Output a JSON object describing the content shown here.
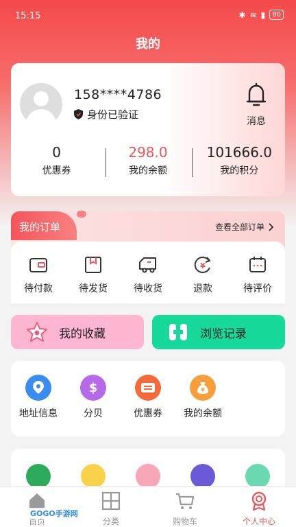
{
  "status_bar": {
    "time": "15:15",
    "battery": "80"
  },
  "page_title": "我的",
  "profile": {
    "phone": "158****4786",
    "verified_text": "身份已验证",
    "message_label": "消息",
    "stats": [
      {
        "value": "0",
        "label": "优惠券",
        "highlight": false
      },
      {
        "value": "298.0",
        "label": "我的余额",
        "highlight": true
      },
      {
        "value": "101666.0",
        "label": "我的积分",
        "highlight": false
      }
    ]
  },
  "orders": {
    "title": "我的订单",
    "view_all": "查看全部订单",
    "items": [
      {
        "label": "待付款",
        "icon": "wallet-icon"
      },
      {
        "label": "待发货",
        "icon": "box-icon"
      },
      {
        "label": "待收货",
        "icon": "truck-icon"
      },
      {
        "label": "退款",
        "icon": "refund-icon"
      },
      {
        "label": "待评价",
        "icon": "review-icon"
      }
    ]
  },
  "quick_actions": {
    "favorites": "我的收藏",
    "history": "浏览记录"
  },
  "services": [
    {
      "label": "地址信息",
      "icon": "location-icon",
      "color": "#3a8df0"
    },
    {
      "label": "分贝",
      "icon": "dollar-icon",
      "color": "#b56ae8"
    },
    {
      "label": "优惠券",
      "icon": "coupon-icon",
      "color": "#f46a3a"
    },
    {
      "label": "我的余额",
      "icon": "moneybag-icon",
      "color": "#f59e3a"
    }
  ],
  "tab_bar": [
    {
      "label": "首页",
      "icon": "home-icon",
      "active": false
    },
    {
      "label": "分类",
      "icon": "grid-icon",
      "active": false
    },
    {
      "label": "购物车",
      "icon": "cart-icon",
      "active": false
    },
    {
      "label": "个人中心",
      "icon": "person-icon",
      "active": true
    }
  ],
  "watermark": "GOGO手游网",
  "colors": {
    "accent": "#e8585a",
    "brand_red": "#f44a4a",
    "history_green": "#17d99a",
    "favorites_pink": "#ffb7d1"
  }
}
